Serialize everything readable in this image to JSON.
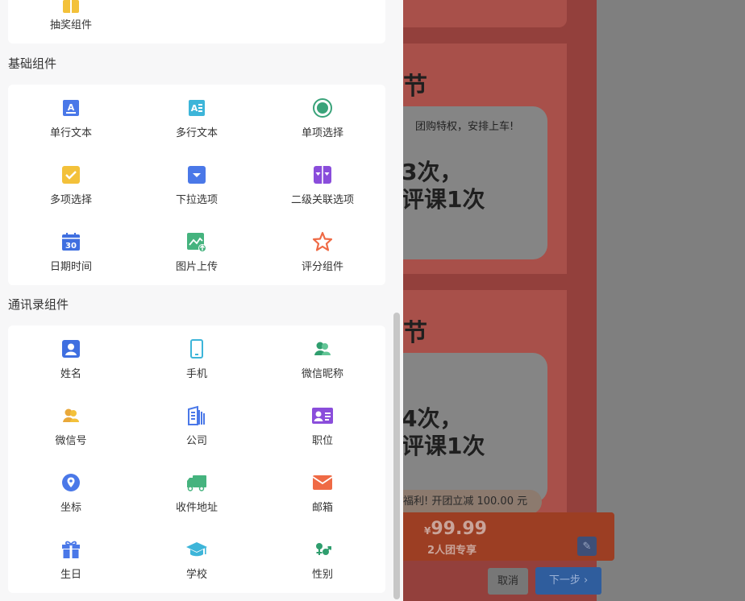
{
  "lottery": {
    "label": "抽奖组件"
  },
  "basic": {
    "title": "基础组件",
    "items": [
      {
        "label": "单行文本",
        "icon": "single-line-text-icon"
      },
      {
        "label": "多行文本",
        "icon": "multi-line-text-icon"
      },
      {
        "label": "单项选择",
        "icon": "radio-icon"
      },
      {
        "label": "多项选择",
        "icon": "checkbox-icon"
      },
      {
        "label": "下拉选项",
        "icon": "dropdown-icon"
      },
      {
        "label": "二级关联选项",
        "icon": "cascade-select-icon"
      },
      {
        "label": "日期时间",
        "icon": "calendar-icon"
      },
      {
        "label": "图片上传",
        "icon": "image-upload-icon"
      },
      {
        "label": "评分组件",
        "icon": "star-icon"
      }
    ]
  },
  "contacts": {
    "title": "通讯录组件",
    "items": [
      {
        "label": "姓名",
        "icon": "person-icon"
      },
      {
        "label": "手机",
        "icon": "phone-icon"
      },
      {
        "label": "微信昵称",
        "icon": "wechat-nickname-icon"
      },
      {
        "label": "微信号",
        "icon": "wechat-id-icon"
      },
      {
        "label": "公司",
        "icon": "building-icon"
      },
      {
        "label": "职位",
        "icon": "id-card-icon"
      },
      {
        "label": "坐标",
        "icon": "location-pin-icon"
      },
      {
        "label": "收件地址",
        "icon": "truck-icon"
      },
      {
        "label": "邮箱",
        "icon": "envelope-icon"
      },
      {
        "label": "生日",
        "icon": "gift-icon"
      },
      {
        "label": "学校",
        "icon": "graduation-cap-icon"
      },
      {
        "label": "性别",
        "icon": "gender-icon"
      }
    ]
  },
  "preview": {
    "heading1": "节",
    "tagline": "团购特权，安排上车!",
    "line1a": "3次，",
    "line1b": "评课1次",
    "heading2": "节",
    "line2a": "4次，",
    "line2b": "评课1次",
    "discount": "福利! 开团立减 100.00 元",
    "price_symbol": "¥",
    "price": "99.99",
    "group": "2人团专享"
  },
  "footer": {
    "cancel": "取消",
    "next": "下一步"
  }
}
